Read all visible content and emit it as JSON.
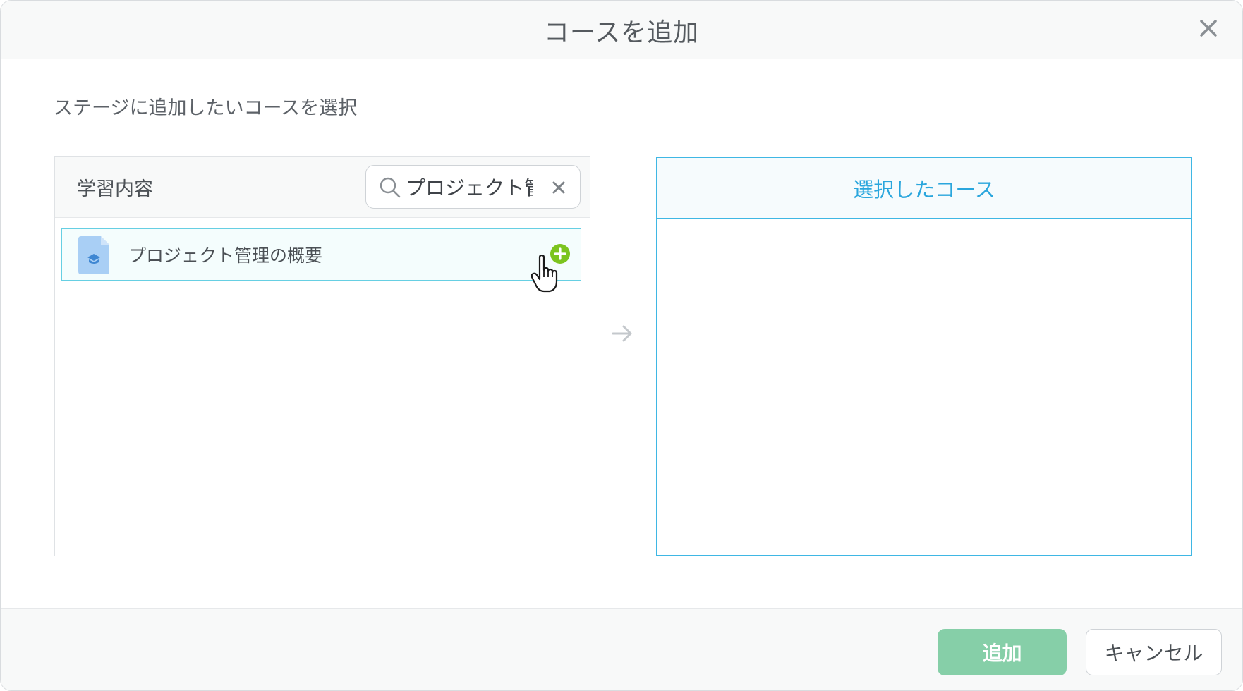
{
  "dialog": {
    "title": "コースを追加",
    "close_icon": "close-icon",
    "instruction": "ステージに追加したいコースを選択"
  },
  "learning": {
    "header_label": "学習内容",
    "search": {
      "value": "プロジェクト管",
      "icon": "search-icon",
      "clear_icon": "clear-icon"
    },
    "items": [
      {
        "name": "プロジェクト管理の概要",
        "icon": "course-document-icon",
        "action_icon": "add-circle-icon"
      }
    ]
  },
  "transfer_icon": "arrow-right-icon",
  "selected": {
    "header_label": "選択したコース",
    "items": []
  },
  "footer": {
    "add_label": "追加",
    "cancel_label": "キャンセル"
  },
  "colors": {
    "accent_blue": "#3fb7e4",
    "add_green": "#86cfa8",
    "plus_green": "#7cc41f",
    "doc_blue": "#a9cff5"
  }
}
